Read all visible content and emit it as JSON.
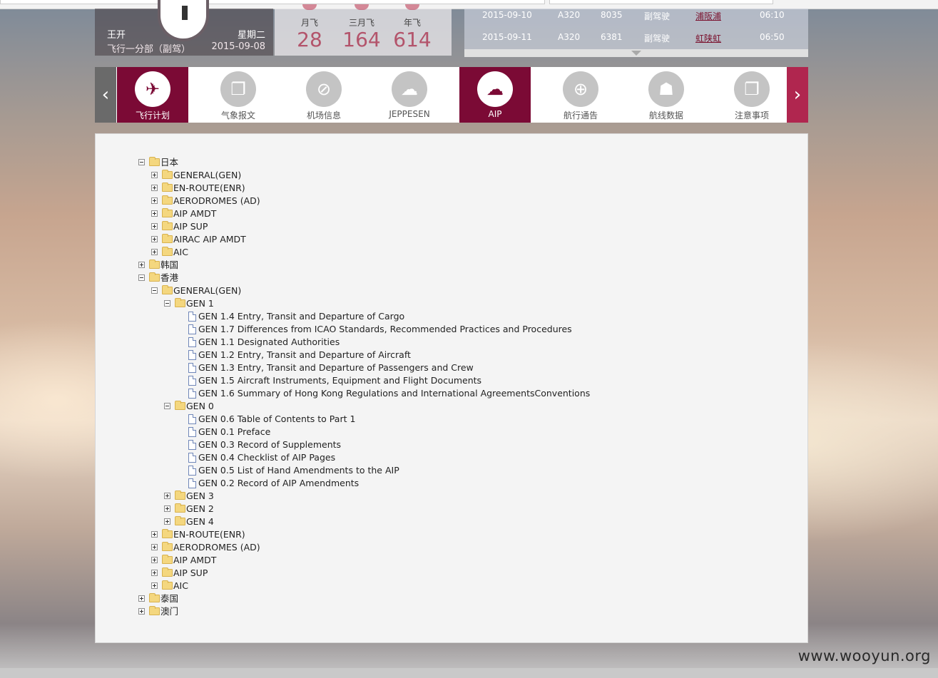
{
  "profile": {
    "name": "王开",
    "weekday": "星期二",
    "department": "飞行一分部（副驾）",
    "date": "2015-09-08"
  },
  "stats": [
    {
      "label": "月飞",
      "value": "28"
    },
    {
      "label": "三月飞",
      "value": "164"
    },
    {
      "label": "年飞",
      "value": "614"
    }
  ],
  "schedule": [
    {
      "date": "2015-09-10",
      "aircraft": "A320",
      "flight": "8035",
      "role": "副驾驶",
      "route": "浦阪浦",
      "time": "06:10"
    },
    {
      "date": "2015-09-11",
      "aircraft": "A320",
      "flight": "6381",
      "role": "副驾驶",
      "route": "虹陕虹",
      "time": "06:50"
    }
  ],
  "nav": {
    "items": [
      {
        "label": "飞行计划",
        "icon": "airplane-icon",
        "active": true
      },
      {
        "label": "气象报文",
        "icon": "chat-bubbles-icon",
        "active": false
      },
      {
        "label": "机场信息",
        "icon": "airport-icon",
        "active": false
      },
      {
        "label": "JEPPESEN",
        "icon": "cloud-lock-icon",
        "active": false
      },
      {
        "label": "AIP",
        "icon": "cloud-lock-icon",
        "active": true
      },
      {
        "label": "航行通告",
        "icon": "globe-icon",
        "active": false
      },
      {
        "label": "航线数据",
        "icon": "group-icon",
        "active": false
      },
      {
        "label": "注意事项",
        "icon": "chat-bubbles-icon",
        "active": false
      }
    ]
  },
  "tree": [
    {
      "level": 0,
      "type": "folder",
      "state": "open",
      "label": "日本"
    },
    {
      "level": 1,
      "type": "folder",
      "state": "closed",
      "label": "GENERAL(GEN)"
    },
    {
      "level": 1,
      "type": "folder",
      "state": "closed",
      "label": "EN-ROUTE(ENR)"
    },
    {
      "level": 1,
      "type": "folder",
      "state": "closed",
      "label": "AERODROMES (AD)"
    },
    {
      "level": 1,
      "type": "folder",
      "state": "closed",
      "label": "AIP AMDT"
    },
    {
      "level": 1,
      "type": "folder",
      "state": "closed",
      "label": "AIP SUP"
    },
    {
      "level": 1,
      "type": "folder",
      "state": "closed",
      "label": "AIRAC AIP AMDT"
    },
    {
      "level": 1,
      "type": "folder",
      "state": "closed",
      "label": "AIC"
    },
    {
      "level": 0,
      "type": "folder",
      "state": "closed",
      "label": "韩国"
    },
    {
      "level": 0,
      "type": "folder",
      "state": "open",
      "label": "香港"
    },
    {
      "level": 1,
      "type": "folder",
      "state": "open",
      "label": "GENERAL(GEN)"
    },
    {
      "level": 2,
      "type": "folder",
      "state": "open",
      "label": "GEN 1"
    },
    {
      "level": 3,
      "type": "doc",
      "label": "GEN 1.4 Entry, Transit and Departure of Cargo"
    },
    {
      "level": 3,
      "type": "doc",
      "label": "GEN 1.7 Differences from ICAO Standards, Recommended Practices and Procedures"
    },
    {
      "level": 3,
      "type": "doc",
      "label": "GEN 1.1 Designated Authorities"
    },
    {
      "level": 3,
      "type": "doc",
      "label": "GEN 1.2 Entry, Transit and Departure of Aircraft"
    },
    {
      "level": 3,
      "type": "doc",
      "label": "GEN 1.3 Entry, Transit and Departure of Passengers and Crew"
    },
    {
      "level": 3,
      "type": "doc",
      "label": "GEN 1.5 Aircraft Instruments, Equipment and Flight Documents"
    },
    {
      "level": 3,
      "type": "doc",
      "label": "GEN 1.6 Summary of Hong Kong Regulations and International AgreementsConventions"
    },
    {
      "level": 2,
      "type": "folder",
      "state": "open",
      "label": "GEN 0"
    },
    {
      "level": 3,
      "type": "doc",
      "label": "GEN 0.6 Table of Contents to Part 1"
    },
    {
      "level": 3,
      "type": "doc",
      "label": "GEN 0.1 Preface"
    },
    {
      "level": 3,
      "type": "doc",
      "label": "GEN 0.3 Record of Supplements"
    },
    {
      "level": 3,
      "type": "doc",
      "label": "GEN 0.4 Checklist of AIP Pages"
    },
    {
      "level": 3,
      "type": "doc",
      "label": "GEN 0.5 List of Hand Amendments to the AIP"
    },
    {
      "level": 3,
      "type": "doc",
      "label": "GEN 0.2 Record of AIP Amendments"
    },
    {
      "level": 2,
      "type": "folder",
      "state": "closed",
      "label": "GEN 3"
    },
    {
      "level": 2,
      "type": "folder",
      "state": "closed",
      "label": "GEN 2"
    },
    {
      "level": 2,
      "type": "folder",
      "state": "closed",
      "label": "GEN 4"
    },
    {
      "level": 1,
      "type": "folder",
      "state": "closed",
      "label": "EN-ROUTE(ENR)"
    },
    {
      "level": 1,
      "type": "folder",
      "state": "closed",
      "label": "AERODROMES (AD)"
    },
    {
      "level": 1,
      "type": "folder",
      "state": "closed",
      "label": "AIP AMDT"
    },
    {
      "level": 1,
      "type": "folder",
      "state": "closed",
      "label": "AIP SUP"
    },
    {
      "level": 1,
      "type": "folder",
      "state": "closed",
      "label": "AIC"
    },
    {
      "level": 0,
      "type": "folder",
      "state": "closed",
      "label": "泰国"
    },
    {
      "level": 0,
      "type": "folder",
      "state": "closed",
      "label": "澳门"
    }
  ],
  "watermark": "www.wooyun.org",
  "colors": {
    "accent": "#7b0a35",
    "nav_arrow_right": "#b0264f",
    "stat_number": "#b3546b"
  }
}
